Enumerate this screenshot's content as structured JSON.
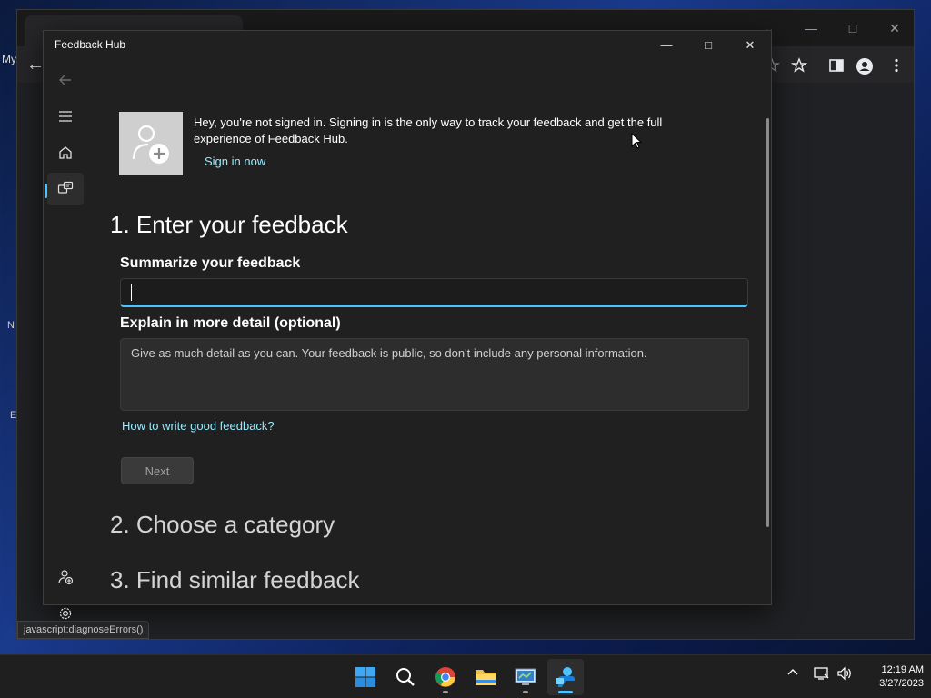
{
  "background_browser": {
    "left_fragment": "My",
    "left_letters": [
      "N",
      "E"
    ],
    "status_bar": "javascript:diagnoseErrors()"
  },
  "window": {
    "title": "Feedback Hub"
  },
  "signin": {
    "message": "Hey, you're not signed in. Signing in is the only way to track your feedback and get the full experience of Feedback Hub.",
    "link": "Sign in now"
  },
  "step1": {
    "heading": "1. Enter your feedback",
    "summary_label": "Summarize your feedback",
    "summary_value": "",
    "detail_label": "Explain in more detail (optional)",
    "detail_placeholder": "Give as much detail as you can. Your feedback is public, so don't include any personal information.",
    "help_link": "How to write good feedback?",
    "next_label": "Next"
  },
  "step2": {
    "heading": "2. Choose a category"
  },
  "step3": {
    "heading": "3. Find similar feedback"
  },
  "taskbar": {
    "time": "12:19 AM",
    "date": "3/27/2023"
  },
  "colors": {
    "accent": "#4cc2ff",
    "link": "#99ebff",
    "window_bg": "#202020"
  }
}
